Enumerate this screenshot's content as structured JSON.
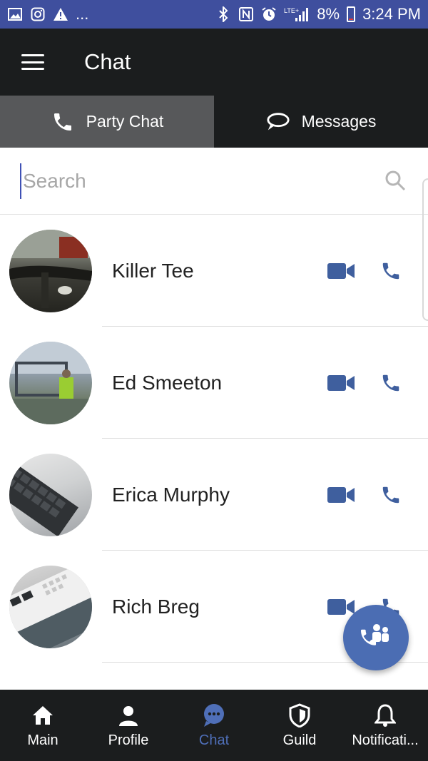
{
  "status_bar": {
    "left_icons": [
      "image-icon",
      "instagram-icon",
      "warning-icon"
    ],
    "more": "...",
    "right_icons": [
      "bluetooth-icon",
      "nfc-icon",
      "alarm-icon",
      "lte-signal-icon"
    ],
    "battery": "8%",
    "time": "3:24 PM"
  },
  "header": {
    "title": "Chat"
  },
  "tabs": [
    {
      "label": "Party Chat",
      "icon": "phone-icon",
      "active": true
    },
    {
      "label": "Messages",
      "icon": "speech-bubble-icon",
      "active": false
    }
  ],
  "search": {
    "placeholder": "Search",
    "value": ""
  },
  "contacts": [
    {
      "name": "Killer Tee"
    },
    {
      "name": "Ed Smeeton"
    },
    {
      "name": "Erica Murphy"
    },
    {
      "name": "Rich Breg"
    }
  ],
  "bottom_nav": [
    {
      "label": "Main",
      "icon": "home-icon",
      "active": false
    },
    {
      "label": "Profile",
      "icon": "person-icon",
      "active": false
    },
    {
      "label": "Chat",
      "icon": "chat-bubble-icon",
      "active": true
    },
    {
      "label": "Guild",
      "icon": "shield-icon",
      "active": false
    },
    {
      "label": "Notificati...",
      "icon": "bell-icon",
      "active": false
    }
  ],
  "colors": {
    "status_bar": "#3f4f9e",
    "app_bar": "#1b1d1e",
    "active_tab": "#57585a",
    "accent": "#3f5f9e",
    "fab": "#4b6db3"
  }
}
